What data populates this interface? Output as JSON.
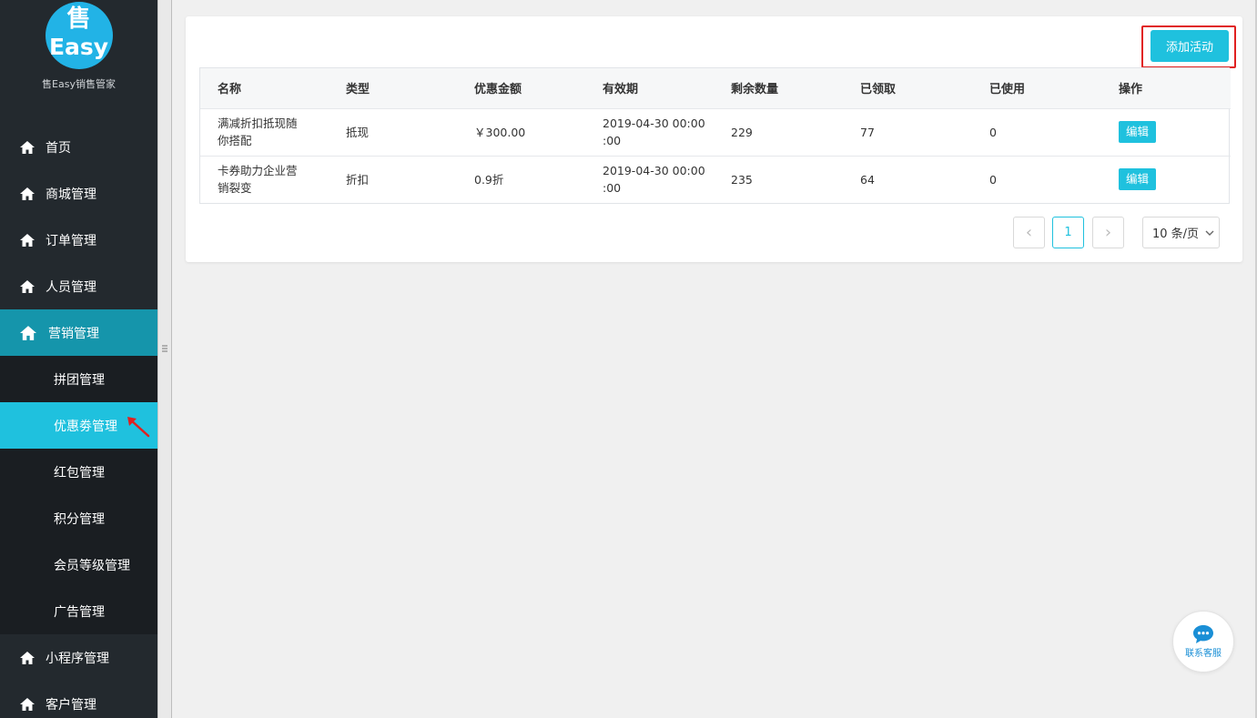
{
  "brand": {
    "logo_top": "售",
    "logo_bottom": "Easy",
    "subtitle": "售Easy销售管家"
  },
  "nav": [
    {
      "label": "首页",
      "icon": "home-icon"
    },
    {
      "label": "商城管理",
      "icon": "home-icon"
    },
    {
      "label": "订单管理",
      "icon": "home-icon"
    },
    {
      "label": "人员管理",
      "icon": "home-icon"
    },
    {
      "label": "营销管理",
      "icon": "home-icon",
      "active": true
    },
    {
      "label": "小程序管理",
      "icon": "home-icon"
    },
    {
      "label": "客户管理",
      "icon": "home-icon"
    }
  ],
  "sub_nav": [
    {
      "label": "拼团管理"
    },
    {
      "label": "优惠劵管理",
      "selected": true
    },
    {
      "label": "红包管理"
    },
    {
      "label": "积分管理"
    },
    {
      "label": "会员等级管理"
    },
    {
      "label": "广告管理"
    }
  ],
  "toolbar": {
    "add_label": "添加活动"
  },
  "table": {
    "headers": [
      "名称",
      "类型",
      "优惠金额",
      "有效期",
      "剩余数量",
      "已领取",
      "已使用",
      "操作"
    ],
    "rows": [
      {
        "name_line1": "满减折扣抵现随",
        "name_line2": "你搭配",
        "type": "抵现",
        "amount": "￥300.00",
        "valid_line1": "2019-04-30 00:00",
        "valid_line2": ":00",
        "remaining": "229",
        "received": "77",
        "used": "0",
        "action": "编辑"
      },
      {
        "name_line1": "卡券助力企业营",
        "name_line2": "销裂变",
        "type": "折扣",
        "amount": "0.9折",
        "valid_line1": "2019-04-30 00:00",
        "valid_line2": ":00",
        "remaining": "235",
        "received": "64",
        "used": "0",
        "action": "编辑"
      }
    ]
  },
  "pagination": {
    "prev": "‹",
    "current": "1",
    "next": "›",
    "page_size": "10 条/页"
  },
  "customer_service": {
    "label": "联系客服"
  },
  "colors": {
    "accent": "#1fc1de",
    "sidebar_bg": "#23292e",
    "active_nav": "#1595ab",
    "highlight_border": "#e02020"
  }
}
